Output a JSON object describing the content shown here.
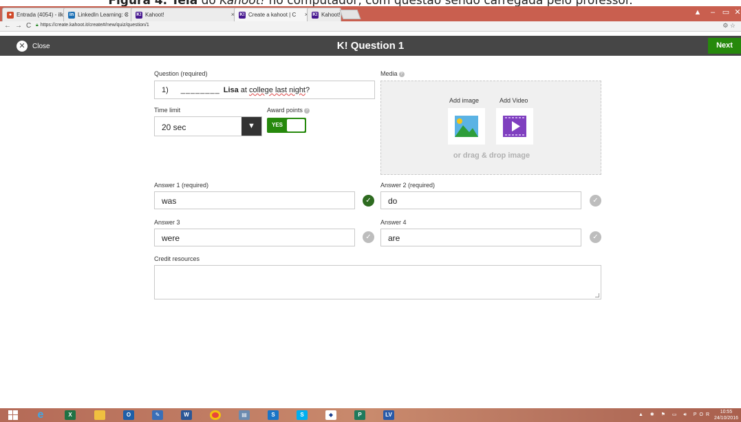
{
  "caption": {
    "bold": "Figura 4. Tela",
    "mid": " do ",
    "italic": "Kahoot!",
    "rest": " no computador, com questão sendo carregada pelo professor."
  },
  "browser": {
    "tabs": [
      {
        "label": "Entrada (4054) - ilk",
        "favcolor": "#d04a2a",
        "fav": "●"
      },
      {
        "label": "LinkedIn Learning: C",
        "favcolor": "#1b6fb4",
        "fav": "in"
      },
      {
        "label": "Kahoot!",
        "favcolor": "#46178f",
        "fav": "K!"
      },
      {
        "label": "Create a kahoot | C",
        "favcolor": "#46178f",
        "fav": "K!"
      },
      {
        "label": "Kahoot!'s new Tean",
        "favcolor": "#46178f",
        "fav": "K!"
      }
    ],
    "url": "https://create.kahoot.it/create#/new/quiz/question/1",
    "nav_icons": "←→C",
    "right_icons": "⚙ ☆"
  },
  "header": {
    "close_label": "Close",
    "title": "K! Question 1",
    "next_label": "Next"
  },
  "form": {
    "question_label": "Question (required)",
    "question": {
      "num": "1)",
      "blank": "________",
      "bold": "Lisa",
      "rest": " at ",
      "underlined": "college last night",
      "end": "?"
    },
    "time_label": "Time limit",
    "time_value": "20 sec",
    "award_label": "Award points",
    "toggle_label": "YES",
    "toggle_on": true,
    "media_label": "Media",
    "add_image": "Add image",
    "add_video": "Add Video",
    "drag_text": "or drag & drop image",
    "answers": [
      {
        "label": "Answer 1 (required)",
        "value": "was",
        "correct": true
      },
      {
        "label": "Answer 2 (required)",
        "value": "do",
        "correct": false
      },
      {
        "label": "Answer 3",
        "value": "were",
        "correct": false
      },
      {
        "label": "Answer 4",
        "value": "are",
        "correct": false
      }
    ],
    "credit_label": "Credit resources"
  },
  "taskbar": {
    "apps": [
      "windows-start",
      "internet-explorer",
      "excel",
      "file-explorer",
      "outlook",
      "onenote",
      "word",
      "chrome",
      "calculator",
      "skype-business",
      "skype",
      "network-app",
      "powerpoint",
      "lv-app"
    ],
    "tray_lang": "POR",
    "time": "10:55",
    "date": "24/10/2016"
  },
  "colors": {
    "header_bg": "#464646",
    "next_green": "#26890c",
    "correct_green": "#2e6b20",
    "media_bg": "#f0f0f0"
  }
}
